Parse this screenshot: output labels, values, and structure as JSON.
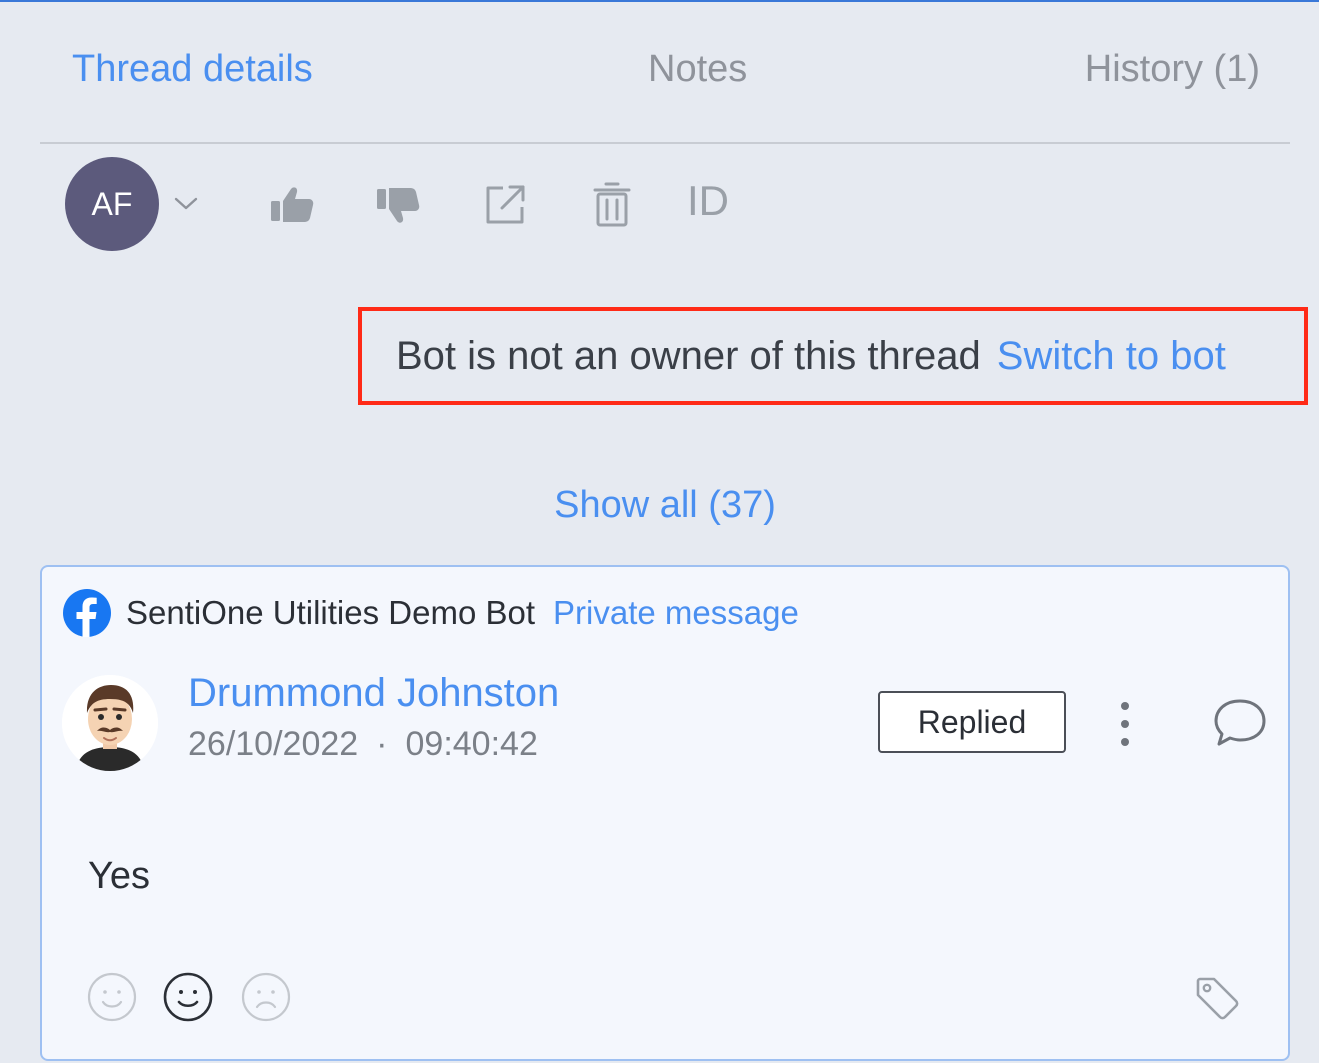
{
  "tabs": [
    {
      "label": "Thread details",
      "active": true
    },
    {
      "label": "Notes",
      "active": false
    },
    {
      "label": "History (1)",
      "active": false
    }
  ],
  "toolbar": {
    "avatar_initials": "AF",
    "avatar_color": "#5c5a7c",
    "icons": [
      "chevron-down-icon",
      "thumbs-up-icon",
      "thumbs-down-icon",
      "external-link-icon",
      "trash-icon"
    ],
    "id_label": "ID"
  },
  "banner": {
    "text": "Bot is not an owner of this thread",
    "link": "Switch to bot",
    "highlight_color": "#ff2a17"
  },
  "show_all": "Show all (37)",
  "message_card": {
    "source_icon": "facebook-icon",
    "source_name": "SentiOne Utilities Demo Bot",
    "source_type": "Private message",
    "author": "Drummond Johnston",
    "date": "26/10/2022",
    "separator": "·",
    "time": "09:40:42",
    "status": "Replied",
    "text": "Yes",
    "sentiment_icons": [
      "smile-icon",
      "neutral-face-icon",
      "sad-face-icon"
    ],
    "selected_sentiment": "neutral"
  },
  "colors": {
    "accent": "#4a8ff0",
    "background": "#e6eaf1",
    "card_border": "#9ec0f2"
  }
}
